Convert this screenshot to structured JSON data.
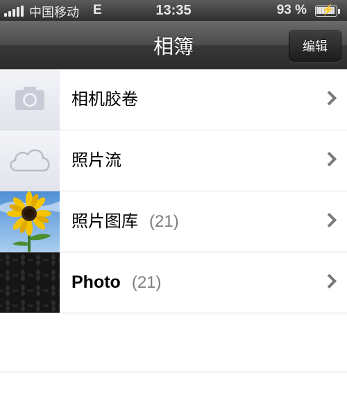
{
  "status_bar": {
    "carrier": "中国移动",
    "network": "E",
    "time": "13:35",
    "battery_percent": "93 %",
    "battery_level": 0.93,
    "icons": [
      "signal-bars-icon",
      "battery-charging-icon"
    ]
  },
  "nav": {
    "title": "相簿",
    "edit_label": "编辑"
  },
  "albums": [
    {
      "name": "相机胶卷",
      "count": "",
      "thumb_icon": "camera-icon"
    },
    {
      "name": "照片流",
      "count": "",
      "thumb_icon": "cloud-icon"
    },
    {
      "name": "照片图库",
      "count": "(21)",
      "thumb_icon": "sunflower-photo"
    },
    {
      "name": "Photo",
      "count": "(21)",
      "thumb_icon": "dark-pattern-photo"
    }
  ],
  "colors": {
    "nav_dark": "#2b2b2b",
    "count_gray": "#7d7d7d",
    "separator": "#dcdcdc"
  }
}
